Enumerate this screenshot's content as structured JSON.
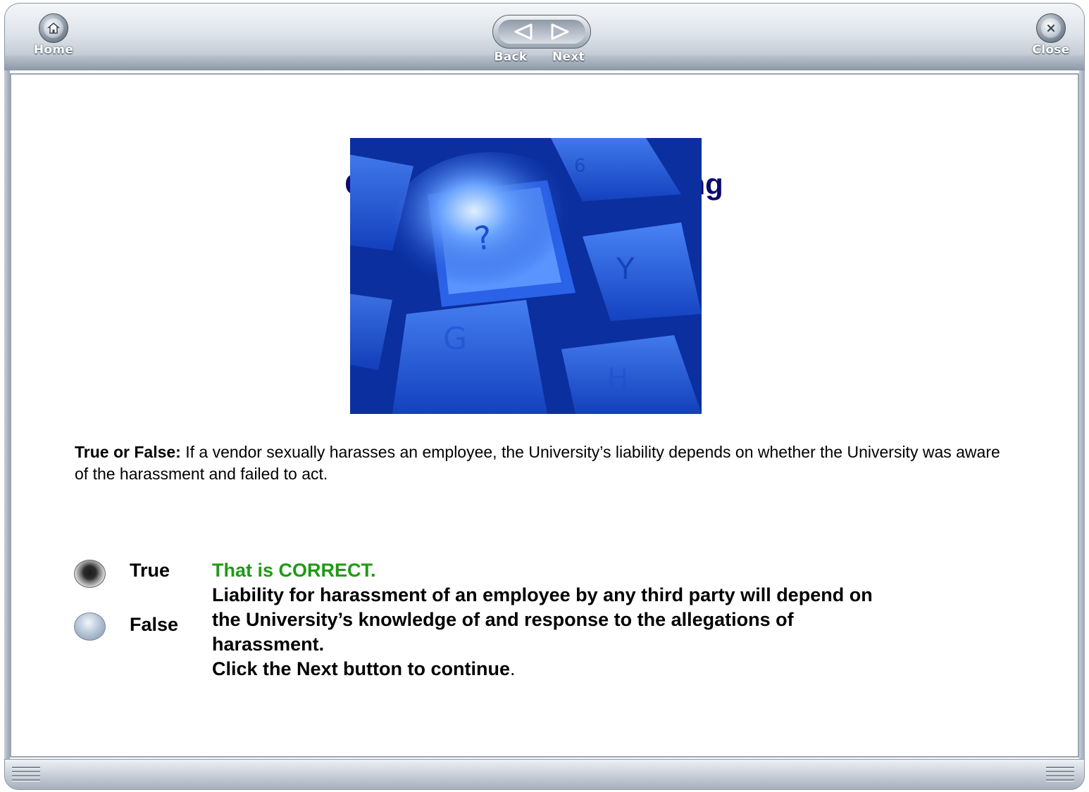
{
  "toolbar": {
    "home_label": "Home",
    "back_label": "Back",
    "next_label": "Next",
    "close_label": "Close"
  },
  "page": {
    "title": "Check Your Understanding",
    "image_icon": "keyboard-question-key-photo"
  },
  "question": {
    "prefix": "True or False:",
    "text": " If a vendor sexually harasses an employee, the University’s liability depends on whether the University was aware of the harassment and failed to act."
  },
  "options": [
    {
      "label": "True",
      "selected": true
    },
    {
      "label": "False",
      "selected": false
    }
  ],
  "feedback": {
    "status": "That is CORRECT.",
    "explanation": "Liability for harassment of an employee by any third party will depend on the University’s knowledge of and response to the allegations of harassment.",
    "instruction_bold": "Click the Next button to continue",
    "instruction_tail": "."
  },
  "colors": {
    "title": "#0a0a6e",
    "correct": "#1f9a15",
    "toolbar": "#c7ced7"
  }
}
